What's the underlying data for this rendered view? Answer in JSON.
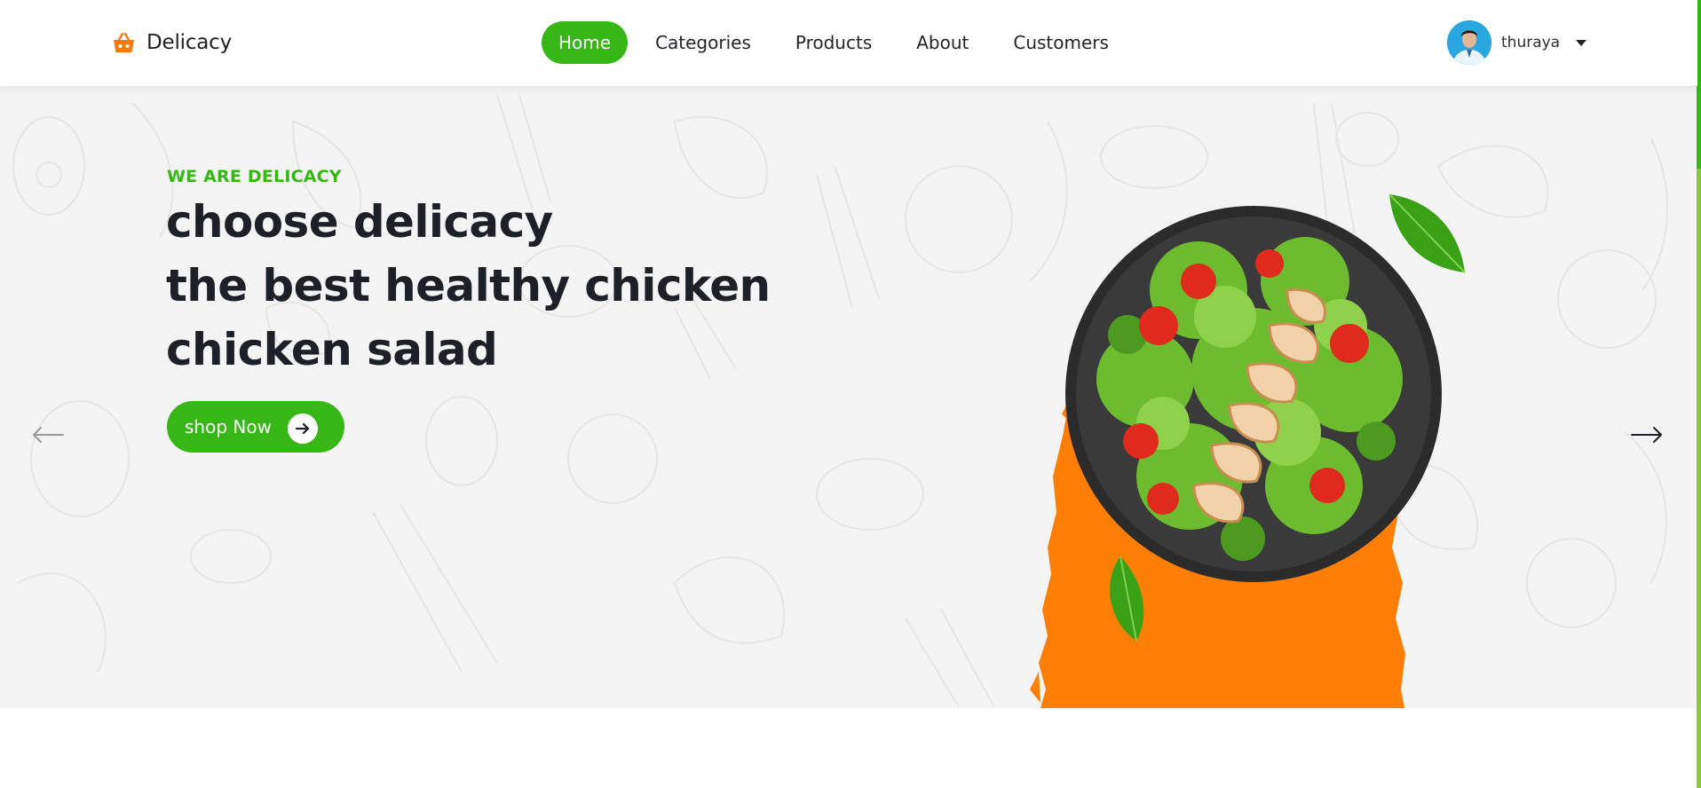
{
  "brand": {
    "name": "Delicacy",
    "icon": "basket-icon",
    "color": "#f57c00"
  },
  "nav": {
    "items": [
      {
        "label": "Home",
        "active": true
      },
      {
        "label": "Categories",
        "active": false
      },
      {
        "label": "Products",
        "active": false
      },
      {
        "label": "About",
        "active": false
      },
      {
        "label": "Customers",
        "active": false
      }
    ]
  },
  "user": {
    "name": "thuraya",
    "avatar": "avatar-icon",
    "menu_icon": "caret-down-icon"
  },
  "hero": {
    "kicker": "WE ARE DELICACY",
    "headline_lines": [
      "choose delicacy",
      "the best healthy chicken",
      "chicken salad"
    ],
    "cta_label": "shop Now",
    "cta_icon": "arrow-right-circle-icon",
    "prev_icon": "arrow-left-icon",
    "next_icon": "arrow-right-icon",
    "image": "chicken-salad-bowl"
  },
  "colors": {
    "accent": "#36b715",
    "orange": "#ff7f06",
    "text": "#1d2127",
    "hero_bg": "#f4f4f4"
  }
}
